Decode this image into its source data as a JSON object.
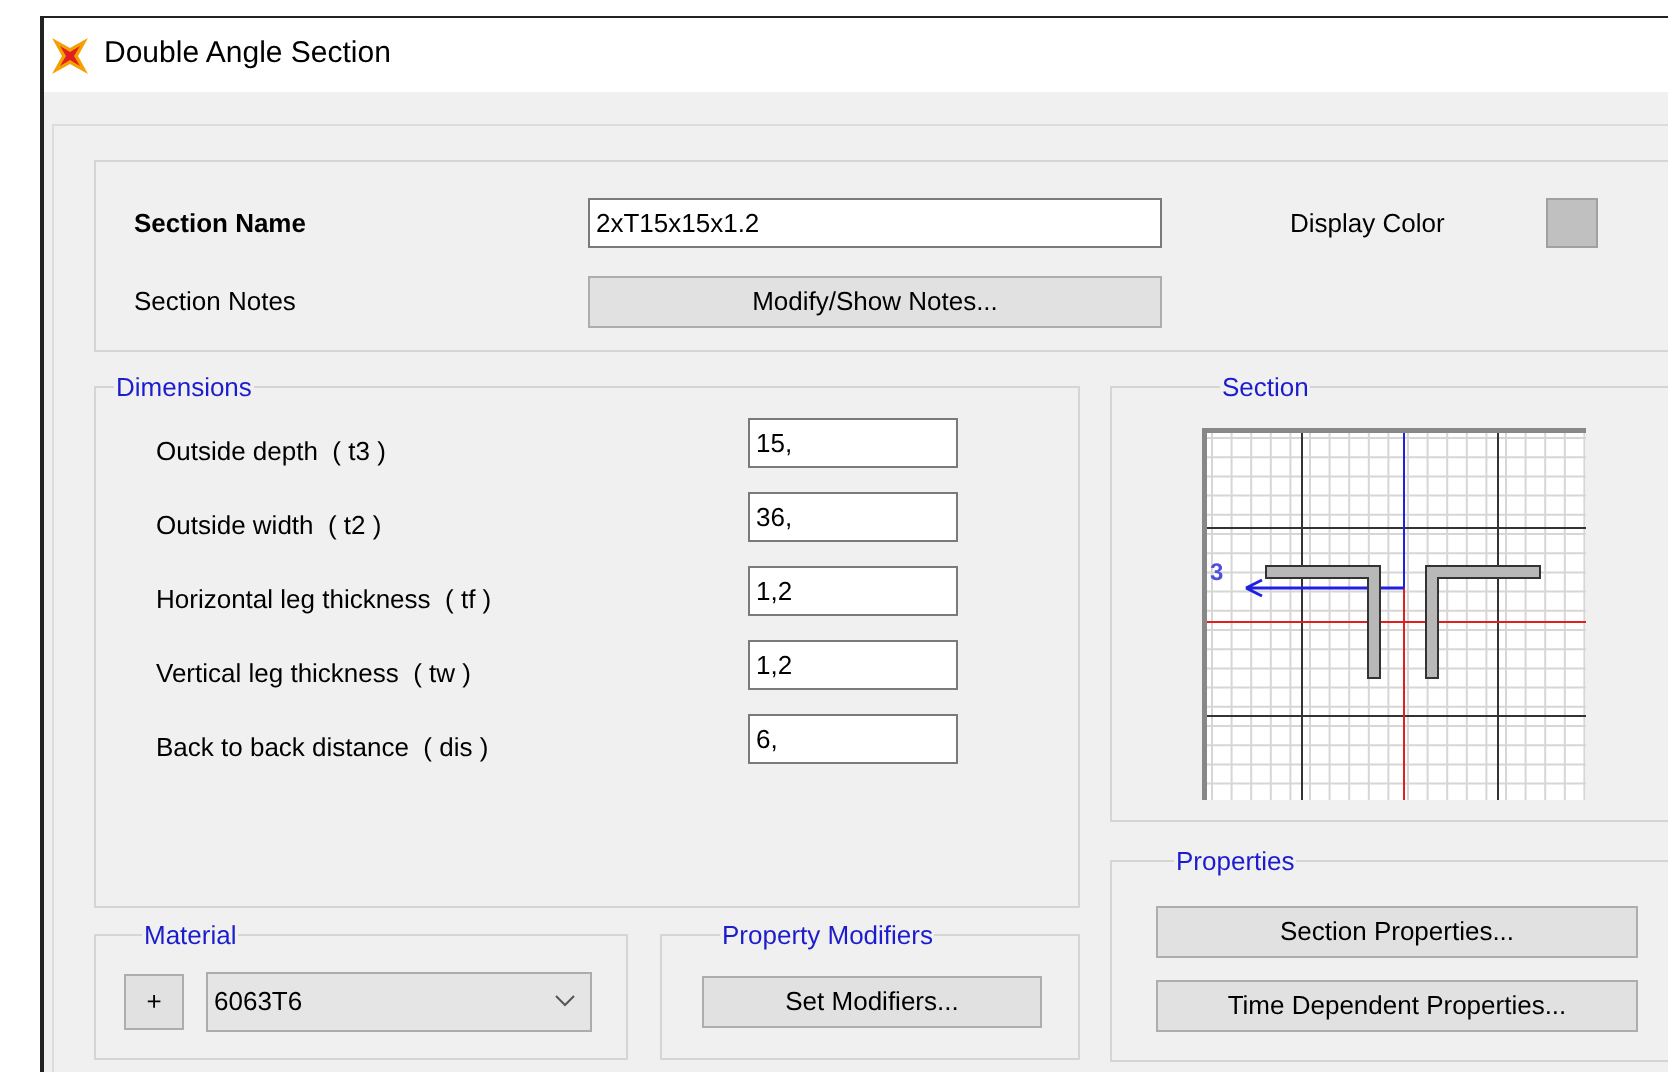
{
  "window": {
    "title": "Double Angle Section"
  },
  "section_name": {
    "label": "Section Name",
    "value": "2xT15x15x1.2"
  },
  "display_color": {
    "label": "Display Color",
    "color": "#c0c0c0"
  },
  "section_notes": {
    "label": "Section Notes",
    "button": "Modify/Show Notes..."
  },
  "dimensions": {
    "title": "Dimensions",
    "fields": [
      {
        "label": "Outside depth  ( t3 )",
        "value": "15,"
      },
      {
        "label": "Outside width  ( t2 )",
        "value": "36,"
      },
      {
        "label": "Horizontal leg thickness  ( tf )",
        "value": "1,2"
      },
      {
        "label": "Vertical leg thickness  ( tw )",
        "value": "1,2"
      },
      {
        "label": "Back to back distance  ( dis )",
        "value": "6,"
      }
    ]
  },
  "section_preview": {
    "title": "Section",
    "axis_label": "3"
  },
  "properties": {
    "title": "Properties",
    "buttons": [
      "Section Properties...",
      "Time Dependent Properties..."
    ]
  },
  "material": {
    "title": "Material",
    "add_button": "+",
    "value": "6063T6"
  },
  "property_modifiers": {
    "title": "Property Modifiers",
    "button": "Set Modifiers..."
  }
}
